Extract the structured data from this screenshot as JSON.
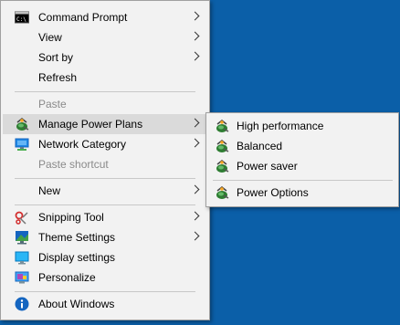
{
  "context_menu": {
    "items": [
      {
        "label": "Command Prompt",
        "icon": "command-prompt-icon",
        "submenu": true
      },
      {
        "label": "View",
        "submenu": true
      },
      {
        "label": "Sort by",
        "submenu": true
      },
      {
        "label": "Refresh"
      },
      {
        "label": "Paste",
        "disabled": true
      },
      {
        "label": "Manage Power Plans",
        "icon": "power-plan-icon",
        "submenu": true
      },
      {
        "label": "Network Category",
        "icon": "network-icon",
        "submenu": true
      },
      {
        "label": "Paste shortcut",
        "disabled": true
      },
      {
        "label": "New",
        "submenu": true
      },
      {
        "label": "Snipping Tool",
        "icon": "snipping-tool-icon",
        "submenu": true
      },
      {
        "label": "Theme Settings",
        "icon": "theme-icon",
        "submenu": true
      },
      {
        "label": "Display settings",
        "icon": "display-icon"
      },
      {
        "label": "Personalize",
        "icon": "personalize-icon"
      },
      {
        "label": "About Windows",
        "icon": "info-icon"
      }
    ]
  },
  "power_submenu": {
    "items": [
      {
        "label": "High performance",
        "icon": "power-plan-icon"
      },
      {
        "label": "Balanced",
        "icon": "power-plan-icon"
      },
      {
        "label": "Power saver",
        "icon": "power-plan-icon"
      },
      {
        "label": "Power Options",
        "icon": "power-plan-icon"
      }
    ]
  },
  "colors": {
    "desktop": "#0b5fa8",
    "menu_bg": "#f2f2f2",
    "highlight": "#dadada",
    "disabled_text": "#8a8a8a"
  }
}
